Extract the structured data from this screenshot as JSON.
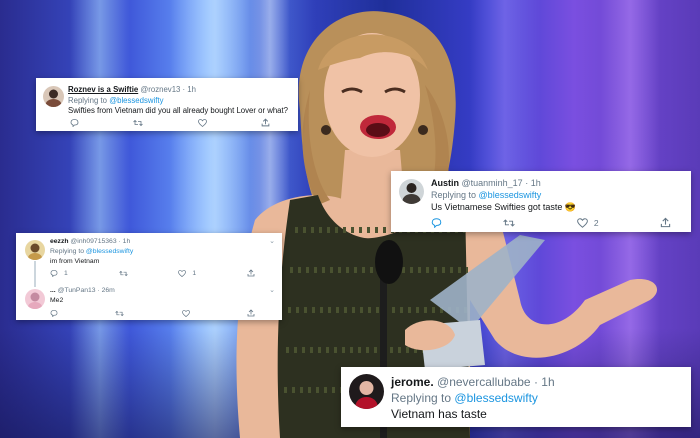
{
  "tweets": [
    {
      "name": "Roznev is a Swiftie",
      "handle": "@roznev13",
      "time": "· 1h",
      "replying_prefix": "Replying to",
      "replying_to": "@blessedswifty",
      "text": "Swifties from Vietnam did you all already bought Lover or what?",
      "avatar_icon": "profile-photo-avatar"
    },
    {
      "name": "Austin",
      "handle": "@tuanminh_17",
      "time": "· 1h",
      "replying_prefix": "Replying to",
      "replying_to": "@blessedswifty",
      "text": "Us Vietnamese Swifties got taste 😎",
      "like_count": "2",
      "avatar_icon": "profile-photo-avatar"
    },
    {
      "name": "jerome.",
      "handle": "@nevercallubabe",
      "time": "· 1h",
      "replying_prefix": "Replying to",
      "replying_to": "@blessedswifty",
      "text": "Vietnam has taste",
      "avatar_icon": "profile-photo-avatar"
    }
  ],
  "thread": {
    "first": {
      "name": "eezzh",
      "handle": "@inh09715363",
      "time": "· 1h",
      "replying_prefix": "Replying to",
      "replying_to": "@blessedswifty",
      "text": "im from Vietnam",
      "reply_count": "1",
      "like_count": "1"
    },
    "second": {
      "name": "...",
      "handle": "@TunPan13",
      "time": "· 26m",
      "text": "Me2"
    }
  },
  "icons": {
    "reply": "reply-icon",
    "retweet": "retweet-icon",
    "like": "like-icon",
    "share": "share-icon",
    "more": "chevron-down-icon"
  },
  "colors": {
    "link": "#1b95e0",
    "muted": "#657786",
    "text": "#14171a",
    "card": "#ffffff"
  }
}
